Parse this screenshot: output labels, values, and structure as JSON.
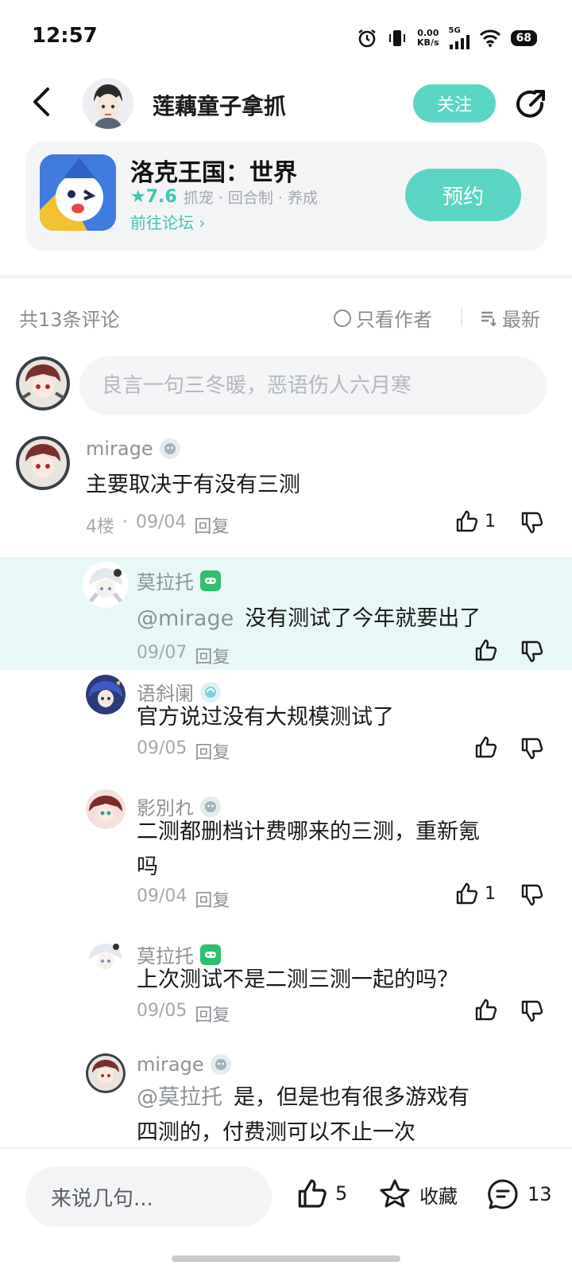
{
  "status_bar": {
    "time": "12:57",
    "net_speed_value": "0.00",
    "net_speed_unit": "KB/s",
    "network": "5G",
    "battery": "68"
  },
  "header": {
    "author_name": "莲藕童子拿抓",
    "follow_label": "关注"
  },
  "game_card": {
    "title": "洛克王国：世界",
    "score": "★7.6",
    "tags": "抓宠 · 回合制 · 养成",
    "forum_link": "前往论坛 ›",
    "reserve_label": "预约"
  },
  "comments_header": {
    "count_label": "共13条评论",
    "only_author_label": "只看作者",
    "sort_label": "最新"
  },
  "composer": {
    "placeholder": "良言一句三冬暖，恶语伤人六月寒"
  },
  "comments": [
    {
      "user": "mirage",
      "text": "主要取决于有没有三测",
      "floor": "4楼",
      "date": "09/04",
      "reply_label": "回复",
      "likes": "1"
    },
    {
      "user": "莫拉托",
      "mention": "@mirage",
      "text": "没有测试了今年就要出了",
      "date": "09/07",
      "reply_label": "回复",
      "likes": ""
    },
    {
      "user": "语斜阑",
      "text": "官方说过没有大规模测试了",
      "date": "09/05",
      "reply_label": "回复",
      "likes": ""
    },
    {
      "user": "影別れ",
      "text_line1": "二测都删档计费哪来的三测，重新氪",
      "text_line2": "吗",
      "date": "09/04",
      "reply_label": "回复",
      "likes": "1"
    },
    {
      "user": "莫拉托",
      "text": "上次测试不是二测三测一起的吗？",
      "date": "09/05",
      "reply_label": "回复",
      "likes": ""
    },
    {
      "user": "mirage",
      "mention": "@莫拉托",
      "text_line1": "是，但是也有很多游戏有",
      "text_line2": "四测的，付费测可以不止一次"
    }
  ],
  "bottom_bar": {
    "input_placeholder": "来说几句...",
    "like_count": "5",
    "favorite_label": "收藏",
    "comment_count": "13"
  },
  "colors": {
    "accent": "#5cd6c4",
    "accent_text": "#3cc7b2",
    "highlight_bg": "#e7f8f6"
  }
}
